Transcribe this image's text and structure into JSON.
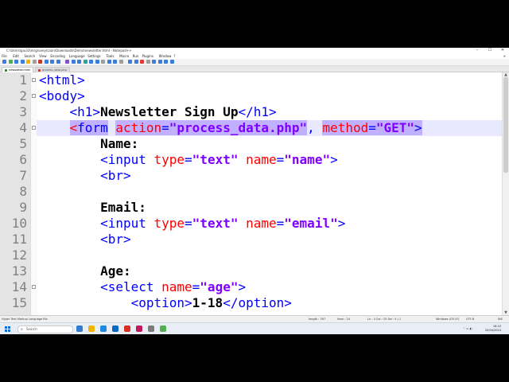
{
  "window": {
    "title": "C:\\Users\\giu33\\mrgrovey\\caan\\Downloads\\Demo\\newsletter.html - Notepad++",
    "controls": [
      "–",
      "☐",
      "✕"
    ]
  },
  "menu": [
    "File",
    "Edit",
    "Search",
    "View",
    "Encoding",
    "Language",
    "Settings",
    "Tools",
    "Macro",
    "Run",
    "Plugins",
    "Window",
    "?"
  ],
  "menu_close": "✕",
  "tabs": [
    {
      "label": "newsletter.html",
      "active": true,
      "color": "#2a7d2a"
    },
    {
      "label": "process_data.php",
      "active": false,
      "color": "#c03030"
    }
  ],
  "editor": {
    "current_line": 4,
    "lines": [
      {
        "n": "1",
        "fold": true,
        "indent": "",
        "tokens": [
          {
            "c": "tag",
            "t": "<html>"
          }
        ]
      },
      {
        "n": "2",
        "fold": true,
        "indent": "",
        "tokens": [
          {
            "c": "tag",
            "t": "<body>"
          }
        ]
      },
      {
        "n": "3",
        "fold": false,
        "indent": "    ",
        "tokens": [
          {
            "c": "tag",
            "t": "<h1>"
          },
          {
            "c": "txt",
            "t": "Newsletter Sign Up"
          },
          {
            "c": "tag",
            "t": "</h1>"
          }
        ]
      },
      {
        "n": "4",
        "fold": true,
        "indent": "    ",
        "tokens": [
          {
            "c": "brace",
            "t": "<"
          },
          {
            "c": "tag match",
            "t": "form"
          },
          {
            "c": "txt",
            "t": " "
          },
          {
            "c": "attr match",
            "t": "action"
          },
          {
            "c": "tag match",
            "t": "="
          },
          {
            "c": "val match",
            "t": "\"process_data.php\""
          },
          {
            "c": "tag",
            "t": ", "
          },
          {
            "c": "attr match",
            "t": "method"
          },
          {
            "c": "tag match",
            "t": "="
          },
          {
            "c": "val match",
            "t": "\"GET\""
          },
          {
            "c": "tag match",
            "t": ">"
          }
        ]
      },
      {
        "n": "5",
        "fold": false,
        "indent": "        ",
        "tokens": [
          {
            "c": "txt",
            "t": "Name:"
          }
        ]
      },
      {
        "n": "6",
        "fold": false,
        "indent": "        ",
        "tokens": [
          {
            "c": "tag",
            "t": "<input "
          },
          {
            "c": "attr",
            "t": "type"
          },
          {
            "c": "tag",
            "t": "="
          },
          {
            "c": "val",
            "t": "\"text\""
          },
          {
            "c": "tag",
            "t": " "
          },
          {
            "c": "attr",
            "t": "name"
          },
          {
            "c": "tag",
            "t": "="
          },
          {
            "c": "val",
            "t": "\"name\""
          },
          {
            "c": "tag",
            "t": ">"
          }
        ]
      },
      {
        "n": "7",
        "fold": false,
        "indent": "        ",
        "tokens": [
          {
            "c": "tag",
            "t": "<br>"
          }
        ]
      },
      {
        "n": "8",
        "fold": false,
        "indent": "",
        "tokens": []
      },
      {
        "n": "9",
        "fold": false,
        "indent": "        ",
        "tokens": [
          {
            "c": "txt",
            "t": "Email:"
          }
        ]
      },
      {
        "n": "10",
        "fold": false,
        "indent": "        ",
        "tokens": [
          {
            "c": "tag",
            "t": "<input "
          },
          {
            "c": "attr",
            "t": "type"
          },
          {
            "c": "tag",
            "t": "="
          },
          {
            "c": "val",
            "t": "\"text\""
          },
          {
            "c": "tag",
            "t": " "
          },
          {
            "c": "attr",
            "t": "name"
          },
          {
            "c": "tag",
            "t": "="
          },
          {
            "c": "val",
            "t": "\"email\""
          },
          {
            "c": "tag",
            "t": ">"
          }
        ]
      },
      {
        "n": "11",
        "fold": false,
        "indent": "        ",
        "tokens": [
          {
            "c": "tag",
            "t": "<br>"
          }
        ]
      },
      {
        "n": "12",
        "fold": false,
        "indent": "",
        "tokens": []
      },
      {
        "n": "13",
        "fold": false,
        "indent": "        ",
        "tokens": [
          {
            "c": "txt",
            "t": "Age:"
          }
        ]
      },
      {
        "n": "14",
        "fold": true,
        "indent": "        ",
        "tokens": [
          {
            "c": "tag",
            "t": "<select "
          },
          {
            "c": "attr",
            "t": "name"
          },
          {
            "c": "tag",
            "t": "="
          },
          {
            "c": "val",
            "t": "\"age\""
          },
          {
            "c": "tag",
            "t": ">"
          }
        ]
      },
      {
        "n": "15",
        "fold": false,
        "indent": "            ",
        "tokens": [
          {
            "c": "tag",
            "t": "<option>"
          },
          {
            "c": "txt",
            "t": "1-18"
          },
          {
            "c": "tag",
            "t": "</option>"
          }
        ]
      }
    ]
  },
  "statusbar": {
    "filetype": "Hyper Text Markup Language file",
    "length": "length : 397",
    "lines": "lines : 24",
    "position": "Ln : 4    Col : 15    Sel : 5 | 1",
    "eol": "Windows (CR LF)",
    "encoding": "UTF-8",
    "mode": "INS"
  },
  "taskbar": {
    "search_placeholder": "Search",
    "apps": [
      "#2e7bd1",
      "#f0b400",
      "#1e88e5",
      "#0a66c2",
      "#d93025",
      "#c2185b",
      "#7b7b7b",
      "#4caf50"
    ],
    "time": "16:10",
    "date": "20/04/2024"
  }
}
